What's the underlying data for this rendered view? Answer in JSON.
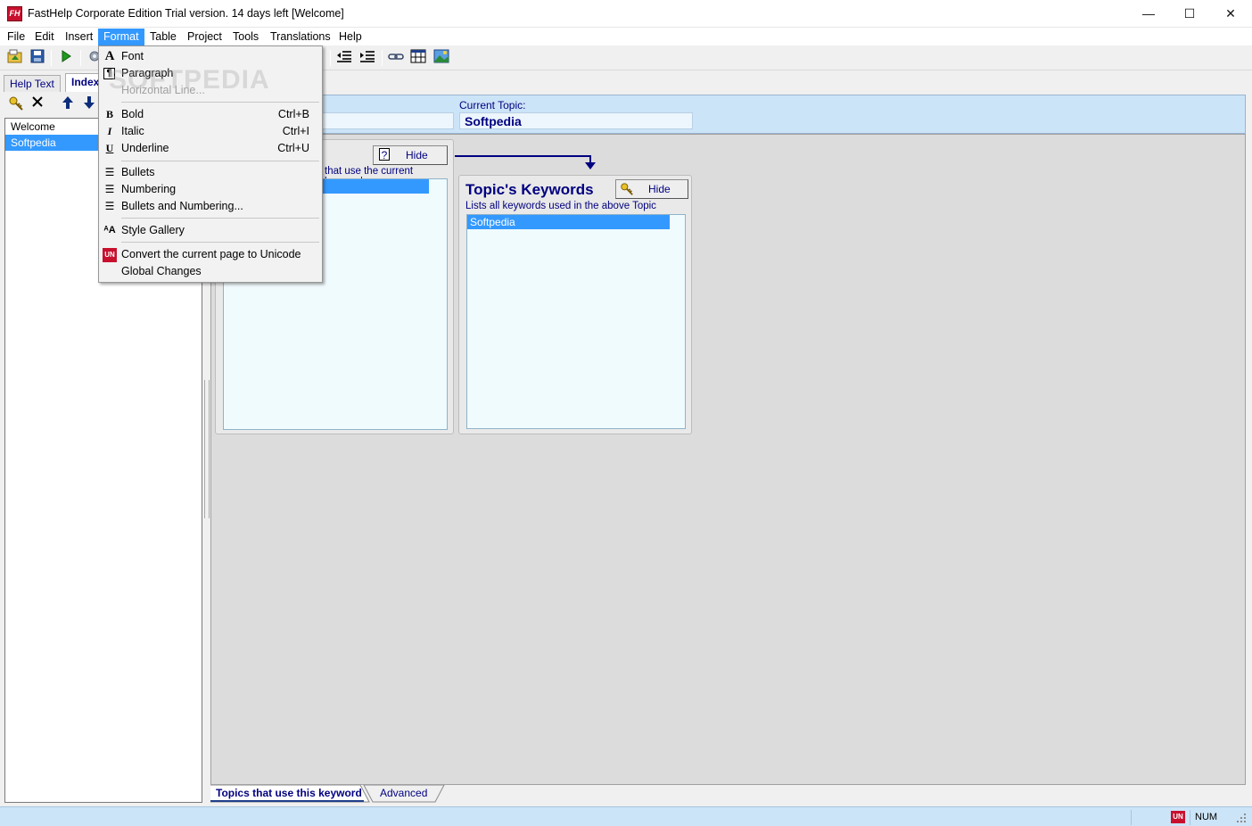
{
  "window": {
    "title": "FastHelp Corporate Edition Trial version. 14 days left [Welcome]",
    "app_icon_text": "FH",
    "minimize_glyph": "—",
    "maximize_glyph": "☐",
    "close_glyph": "✕"
  },
  "menubar": [
    {
      "label": "File"
    },
    {
      "label": "Edit"
    },
    {
      "label": "Insert"
    },
    {
      "label": "Format"
    },
    {
      "label": "Table"
    },
    {
      "label": "Project"
    },
    {
      "label": "Tools"
    },
    {
      "label": "Translations"
    },
    {
      "label": "Help"
    }
  ],
  "format_menu": {
    "items": [
      {
        "label": "Font",
        "icon": "font-icon",
        "glyph": "A",
        "shortcut": ""
      },
      {
        "label": "Paragraph",
        "icon": "paragraph-icon",
        "glyph": "¶",
        "shortcut": ""
      },
      {
        "label": "Horizontal Line...",
        "icon": "",
        "glyph": "",
        "shortcut": "",
        "disabled": true
      },
      {
        "label": "Bold",
        "icon": "bold-icon",
        "glyph": "B",
        "shortcut": "Ctrl+B"
      },
      {
        "label": "Italic",
        "icon": "italic-icon",
        "glyph": "I",
        "shortcut": "Ctrl+I"
      },
      {
        "label": "Underline",
        "icon": "underline-icon",
        "glyph": "U",
        "shortcut": "Ctrl+U"
      },
      {
        "label": "Bullets",
        "icon": "bullets-icon",
        "glyph": "☰",
        "shortcut": ""
      },
      {
        "label": "Numbering",
        "icon": "numbering-icon",
        "glyph": "☰",
        "shortcut": ""
      },
      {
        "label": "Bullets and Numbering...",
        "icon": "bullets-numbering-icon",
        "glyph": "☰",
        "shortcut": ""
      },
      {
        "label": "Style Gallery",
        "icon": "style-gallery-icon",
        "glyph": "ᴬA",
        "shortcut": ""
      },
      {
        "label": "Convert the current page to Unicode",
        "icon": "unicode-icon",
        "glyph": "UN",
        "shortcut": ""
      },
      {
        "label": "Global Changes",
        "icon": "",
        "glyph": "",
        "shortcut": ""
      }
    ]
  },
  "watermark": "SOFTPEDIA",
  "left_tabs": [
    {
      "label": "Help Text"
    },
    {
      "label": "Index"
    }
  ],
  "index_list": [
    {
      "label": "Welcome"
    },
    {
      "label": "Softpedia"
    }
  ],
  "header": {
    "current_topic_label": "Current Topic:",
    "current_topic_value": "Softpedia"
  },
  "left_panel": {
    "description": "that use the current keyword",
    "hide_label": "Hide",
    "hide_glyph": "?"
  },
  "keywords_panel": {
    "title": "Topic's Keywords",
    "description": "Lists all keywords used in the above Topic",
    "hide_label": "Hide",
    "items": [
      {
        "label": "Softpedia"
      }
    ]
  },
  "bottom_tabs": [
    {
      "label": "Topics that use this keyword"
    },
    {
      "label": "Advanced"
    }
  ],
  "statusbar": {
    "num": "NUM",
    "unicode_badge": "UN"
  },
  "colors": {
    "accent": "#3399ff",
    "navy_text": "#000080",
    "header_bg": "#cce4f7",
    "list_bg": "#f0fbfe"
  }
}
